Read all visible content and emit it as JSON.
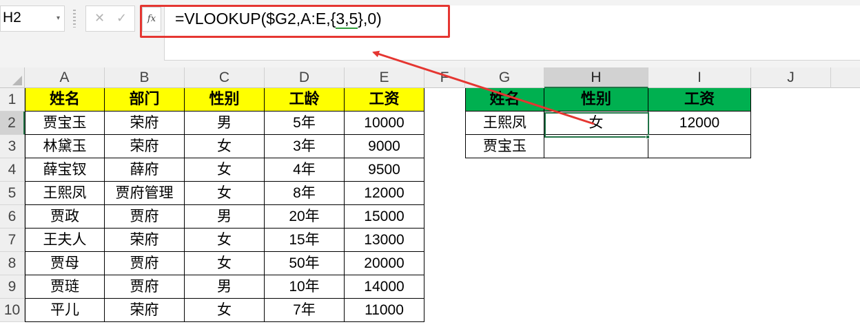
{
  "namebox": {
    "value": "H2",
    "arrow": "▾"
  },
  "formula_bar": {
    "cancel_icon": "✕",
    "enter_icon": "✓",
    "fx_label": "fx",
    "formula_prefix": "=VLOOKUP($G2,A:E,",
    "formula_brace_open": "{",
    "formula_const": "3,5",
    "formula_brace_close": "}",
    "formula_suffix": ",0)"
  },
  "columns": [
    "A",
    "B",
    "C",
    "D",
    "E",
    "F",
    "G",
    "H",
    "I",
    "J"
  ],
  "selected_column": "H",
  "rows": [
    "1",
    "2",
    "3",
    "4",
    "5",
    "6",
    "7",
    "8",
    "9",
    "10"
  ],
  "selected_row": "2",
  "table1": {
    "headers": [
      "姓名",
      "部门",
      "性别",
      "工龄",
      "工资"
    ],
    "rows": [
      [
        "贾宝玉",
        "荣府",
        "男",
        "5年",
        "10000"
      ],
      [
        "林黛玉",
        "荣府",
        "女",
        "3年",
        "9000"
      ],
      [
        "薛宝钗",
        "薛府",
        "女",
        "4年",
        "9500"
      ],
      [
        "王熙凤",
        "贾府管理",
        "女",
        "8年",
        "12000"
      ],
      [
        "贾政",
        "贾府",
        "男",
        "20年",
        "15000"
      ],
      [
        "王夫人",
        "荣府",
        "女",
        "15年",
        "13000"
      ],
      [
        "贾母",
        "贾府",
        "女",
        "50年",
        "20000"
      ],
      [
        "贾琏",
        "贾府",
        "男",
        "10年",
        "14000"
      ],
      [
        "平儿",
        "荣府",
        "女",
        "7年",
        "11000"
      ]
    ]
  },
  "table2": {
    "headers": [
      "姓名",
      "性别",
      "工资"
    ],
    "rows": [
      [
        "王熙凤",
        "女",
        "12000"
      ],
      [
        "贾宝玉",
        "",
        ""
      ]
    ]
  },
  "colors": {
    "header_yellow": "#ffff00",
    "header_green": "#00b050",
    "annotation_red": "#e53631",
    "selection_green": "#217346"
  }
}
